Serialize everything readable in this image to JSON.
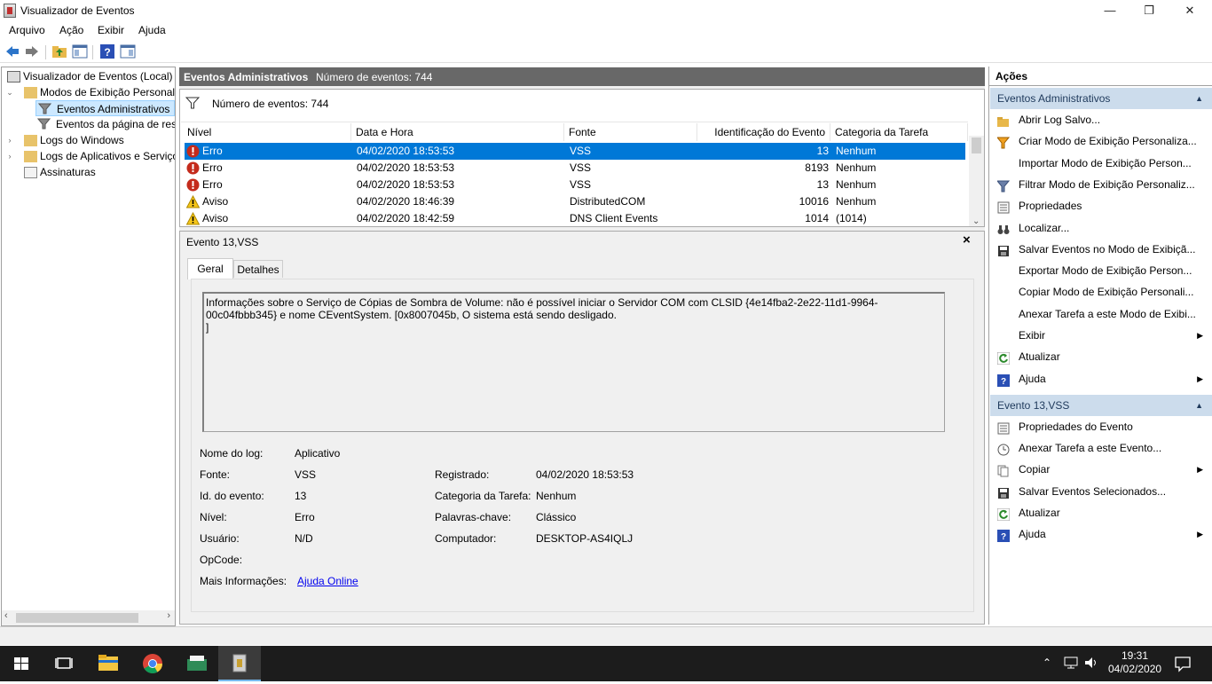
{
  "window": {
    "title": "Visualizador de Eventos",
    "minimize": "—",
    "maximize": "❐",
    "close": "✕"
  },
  "menu": [
    "Arquivo",
    "Ação",
    "Exibir",
    "Ajuda"
  ],
  "tree": {
    "root": "Visualizador de Eventos (Local)",
    "custom_views": "Modos de Exibição Personalizados",
    "admin_events": "Eventos Administrativos",
    "summary_page": "Eventos da página de resumo",
    "windows_logs": "Logs do Windows",
    "app_logs": "Logs de Aplicativos e Serviços",
    "subscriptions": "Assinaturas"
  },
  "center": {
    "header_title": "Eventos Administrativos",
    "header_count": "Número de eventos: 744",
    "filter_count": "Número de eventos: 744",
    "columns": [
      "Nível",
      "Data e Hora",
      "Fonte",
      "Identificação do Evento",
      "Categoria da Tarefa"
    ],
    "rows": [
      {
        "level": "Erro",
        "date": "04/02/2020 18:53:53",
        "source": "VSS",
        "id": "13",
        "category": "Nenhum",
        "type": "error"
      },
      {
        "level": "Erro",
        "date": "04/02/2020 18:53:53",
        "source": "VSS",
        "id": "8193",
        "category": "Nenhum",
        "type": "error"
      },
      {
        "level": "Erro",
        "date": "04/02/2020 18:53:53",
        "source": "VSS",
        "id": "13",
        "category": "Nenhum",
        "type": "error"
      },
      {
        "level": "Aviso",
        "date": "04/02/2020 18:46:39",
        "source": "DistributedCOM",
        "id": "10016",
        "category": "Nenhum",
        "type": "warning"
      },
      {
        "level": "Aviso",
        "date": "04/02/2020 18:42:59",
        "source": "DNS Client Events",
        "id": "1014",
        "category": "(1014)",
        "type": "warning"
      }
    ]
  },
  "detail": {
    "title": "Evento 13,VSS",
    "tabs": [
      "Geral",
      "Detalhes"
    ],
    "message": "Informações sobre o Serviço de Cópias de Sombra de Volume: não é possível iniciar o Servidor COM com CLSID {4e14fba2-2e22-11d1-9964-00c04fbbb345} e nome CEventSystem. [0x8007045b, O sistema está sendo desligado.\n]",
    "fields": {
      "log_name_label": "Nome do log:",
      "log_name": "Aplicativo",
      "source_label": "Fonte:",
      "source": "VSS",
      "logged_label": "Registrado:",
      "logged": "04/02/2020 18:53:53",
      "event_id_label": "Id. do evento:",
      "event_id": "13",
      "task_cat_label": "Categoria da Tarefa:",
      "task_cat": "Nenhum",
      "level_label": "Nível:",
      "level": "Erro",
      "keywords_label": "Palavras-chave:",
      "keywords": "Clássico",
      "user_label": "Usuário:",
      "user": "N/D",
      "computer_label": "Computador:",
      "computer": "DESKTOP-AS4IQLJ",
      "opcode_label": "OpCode:",
      "more_info_label": "Mais Informações:",
      "more_info_link": "Ajuda Online"
    }
  },
  "actions": {
    "header": "Ações",
    "section1": "Eventos Administrativos",
    "items1": [
      {
        "label": "Abrir Log Salvo...",
        "icon": "folder-open-icon"
      },
      {
        "label": "Criar Modo de Exibição Personaliza...",
        "icon": "filter-star-icon"
      },
      {
        "label": "Importar Modo de Exibição Person...",
        "icon": ""
      },
      {
        "label": "Filtrar Modo de Exibição Personaliz...",
        "icon": "filter-icon"
      },
      {
        "label": "Propriedades",
        "icon": "properties-icon"
      },
      {
        "label": "Localizar...",
        "icon": "binoculars-icon"
      },
      {
        "label": "Salvar Eventos no Modo de Exibiçã...",
        "icon": "save-icon"
      },
      {
        "label": "Exportar Modo de Exibição Person...",
        "icon": ""
      },
      {
        "label": "Copiar Modo de Exibição Personali...",
        "icon": ""
      },
      {
        "label": "Anexar Tarefa a este Modo de Exibi...",
        "icon": ""
      },
      {
        "label": "Exibir",
        "icon": "",
        "sub": true
      },
      {
        "label": "Atualizar",
        "icon": "refresh-icon"
      },
      {
        "label": "Ajuda",
        "icon": "help-icon",
        "sub": true
      }
    ],
    "section2": "Evento 13,VSS",
    "items2": [
      {
        "label": "Propriedades do Evento",
        "icon": "properties-icon"
      },
      {
        "label": "Anexar Tarefa a este Evento...",
        "icon": "task-icon"
      },
      {
        "label": "Copiar",
        "icon": "copy-icon",
        "sub": true
      },
      {
        "label": "Salvar Eventos Selecionados...",
        "icon": "save-icon"
      },
      {
        "label": "Atualizar",
        "icon": "refresh-icon"
      },
      {
        "label": "Ajuda",
        "icon": "help-icon",
        "sub": true
      }
    ]
  },
  "taskbar": {
    "time": "19:31",
    "date": "04/02/2020"
  }
}
